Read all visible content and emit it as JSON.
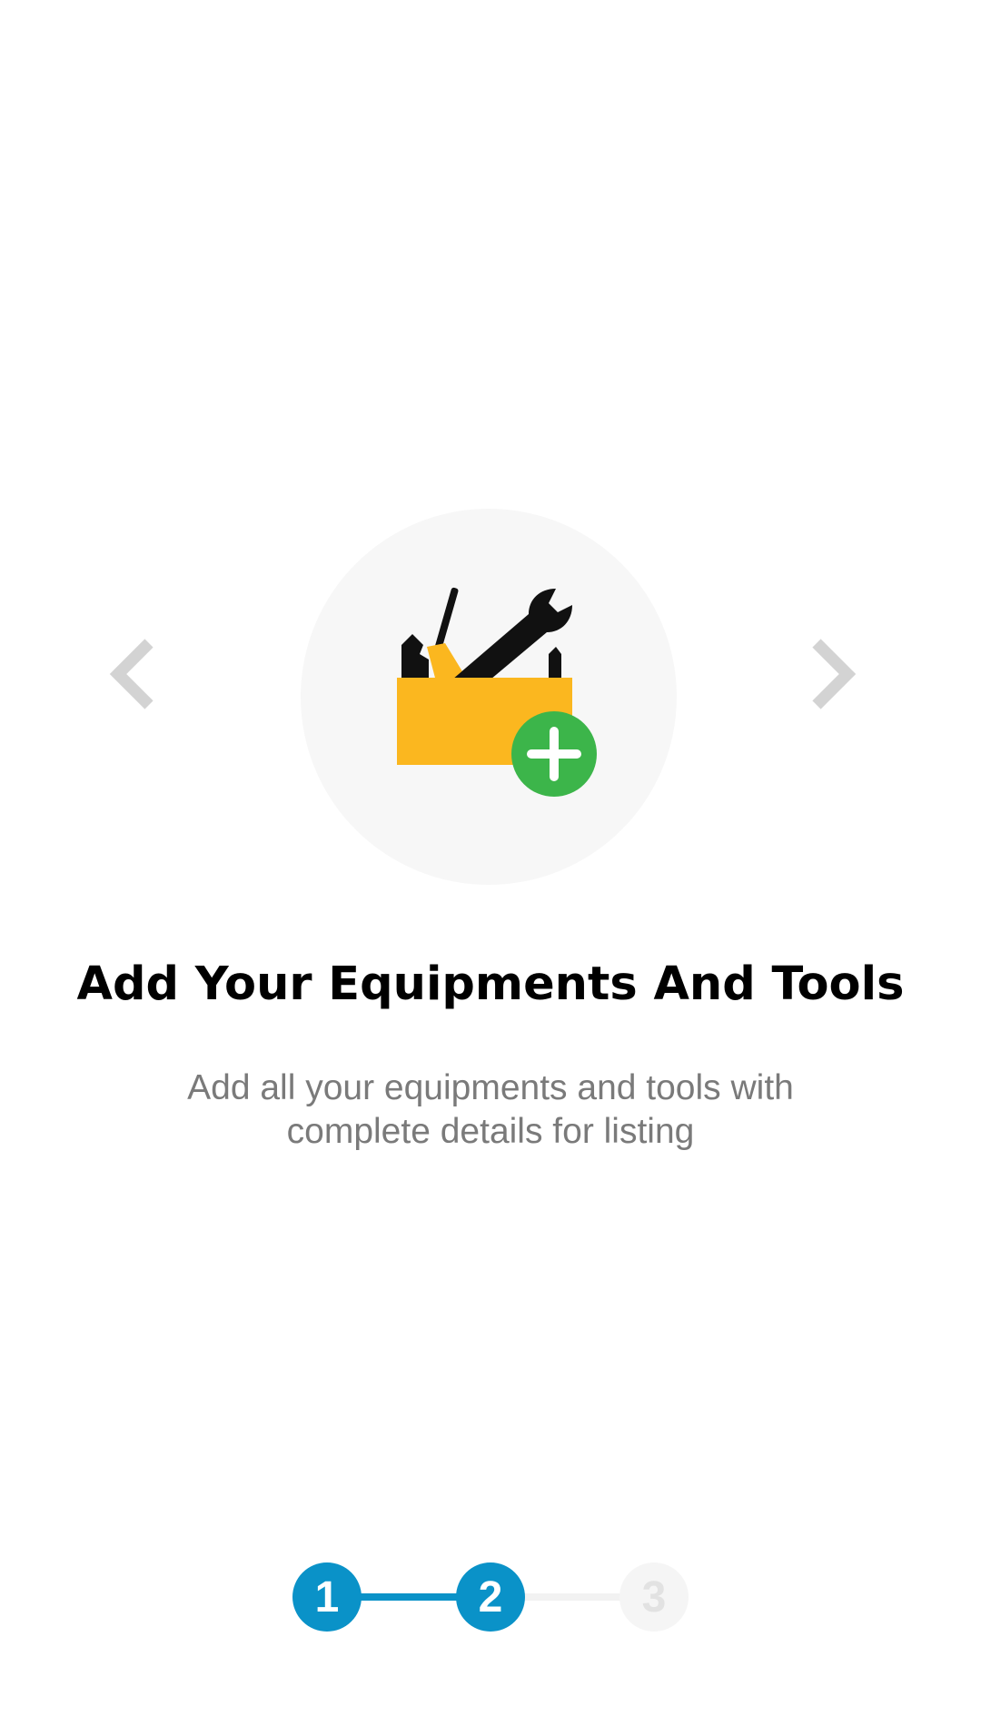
{
  "colors": {
    "accent": "#0a92c8",
    "inactive_step_bg": "#f5f5f5",
    "inactive_step_text": "#e2e2e2",
    "inactive_connector": "#f2f2f2",
    "arrow": "#d3d3d3",
    "toolbox_yellow": "#fbb71f",
    "plus_green": "#3cb54a"
  },
  "navigation": {
    "prev_icon": "chevron-left-icon",
    "next_icon": "chevron-right-icon"
  },
  "illustration": {
    "icon": "toolbox-add-icon"
  },
  "onboarding": {
    "title": "Add Your Equipments And Tools",
    "description": "Add all your equipments and tools with complete details for listing"
  },
  "stepper": {
    "current_step": 2,
    "total_steps": 3,
    "steps": [
      {
        "label": "1",
        "state": "completed"
      },
      {
        "label": "2",
        "state": "active"
      },
      {
        "label": "3",
        "state": "inactive"
      }
    ]
  }
}
